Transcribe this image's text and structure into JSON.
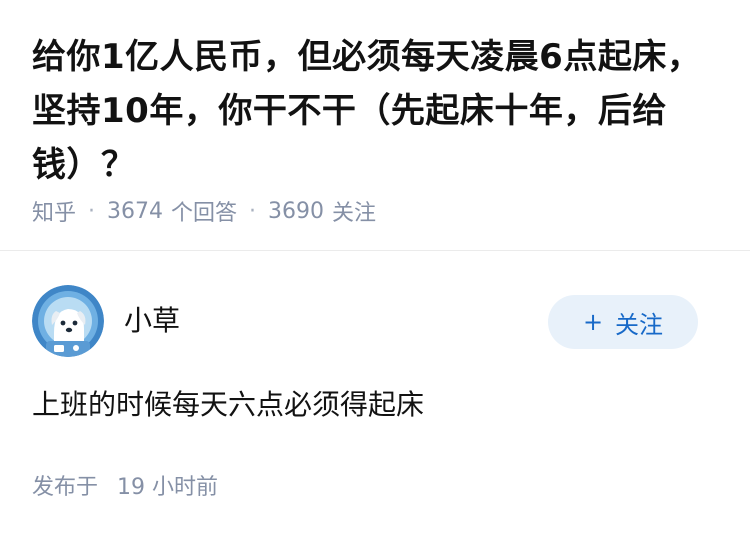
{
  "question": {
    "title": "给你1亿人民币，但必须每天凌晨6点起床，坚持10年，你干不干（先起床十年，后给钱）？",
    "source": "知乎",
    "answer_count": "3674",
    "answer_label": "个回答",
    "follower_count": "3690",
    "follower_label": "关注"
  },
  "answer": {
    "author_name": "小草",
    "follow_button_label": "关注",
    "follow_button_icon": "plus-icon",
    "content": "上班的时候每天六点必须得起床",
    "published_label": "发布于",
    "published_time": "19 小时前"
  },
  "colors": {
    "accent": "#1769c8",
    "follow_button_bg": "#e8f1fa",
    "meta_text": "#8590a6",
    "title_text": "#121212",
    "avatar_bg": "#3f86c7"
  }
}
